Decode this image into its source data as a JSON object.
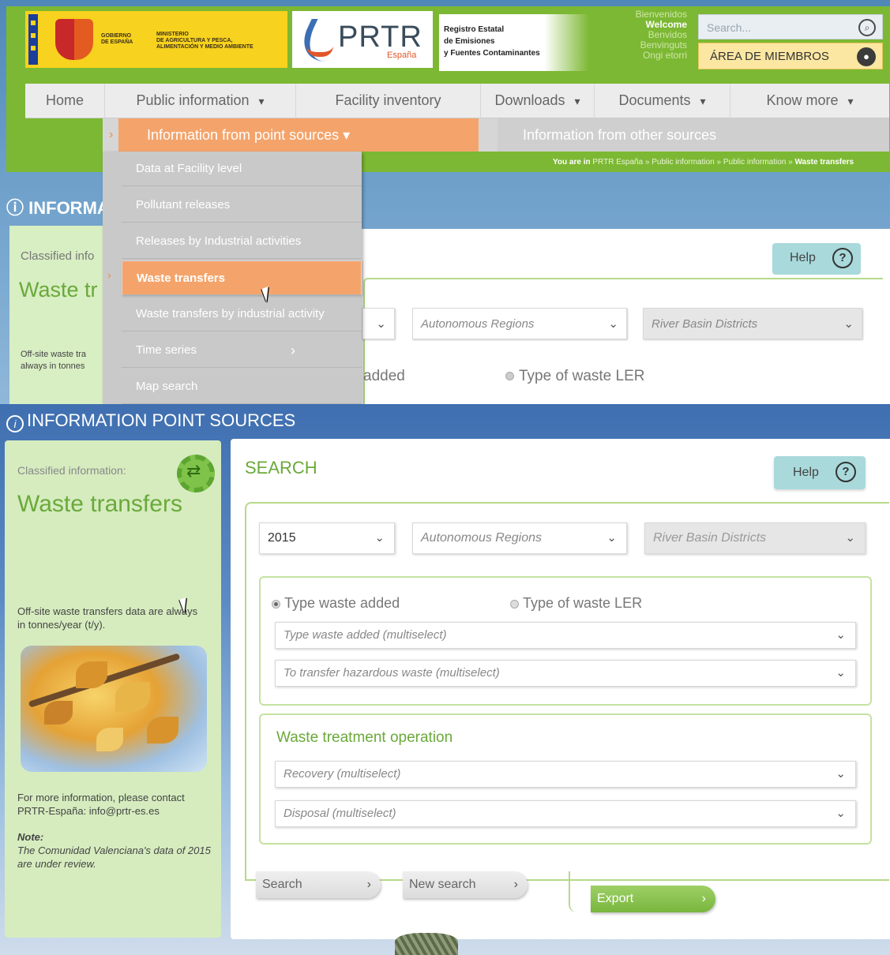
{
  "top": {
    "gov": {
      "line1": "GOBIERNO",
      "line2": "DE ESPAÑA",
      "ministry1": "MINISTERIO",
      "ministry2": "DE AGRICULTURA Y PESCA,",
      "ministry3": "ALIMENTACIÓN Y MEDIO AMBIENTE"
    },
    "brand": {
      "name": "PRTR",
      "country": "España",
      "reg1": "Registro Estatal",
      "reg2": "de Emisiones",
      "reg3": "y Fuentes Contaminantes"
    },
    "welcome": [
      "Bienvenidos",
      "Welcome",
      "Benvidos",
      "Benvinguts",
      "Ongi etorri"
    ],
    "search_placeholder": "Search...",
    "members_label": "ÁREA DE MIEMBROS",
    "nav": [
      "Home",
      "Public information",
      "Facility inventory",
      "Downloads",
      "Documents",
      "Know more"
    ],
    "subnav": {
      "active": "Information from point sources",
      "other": "Information from other sources"
    },
    "breadcrumb": {
      "prefix": "You are in",
      "path": "PRTR España » Public information » Public information » ",
      "current": "Waste transfers"
    },
    "dropdown": [
      "Data at Facility level",
      "Pollutant releases",
      "Releases by Industrial activities",
      "Waste transfers",
      "Waste transfers by industrial activity",
      "Time series",
      "Map search"
    ],
    "info_title": "INFORMA",
    "classified": "Classified info",
    "waste_title": "Waste tr",
    "offsite1": "Off-site waste tra",
    "offsite2": "always in tonnes",
    "help": "Help",
    "autonomous": "Autonomous Regions",
    "river": "River Basin Districts",
    "radio1": "added",
    "radio2": "Type of waste LER"
  },
  "bottom": {
    "title": "INFORMATION POINT SOURCES",
    "sidebar": {
      "classified": "Classified information:",
      "heading": "Waste transfers",
      "offsite": "Off-site waste transfers data are always in tonnes/year (t/y).",
      "more": "For more information, please contact PRTR-España: info@prtr-es.es",
      "note_label": "Note:",
      "note": "The Comunidad Valenciana's data of 2015 are under review."
    },
    "search_title": "SEARCH",
    "help": "Help",
    "year": "2015",
    "autonomous": "Autonomous Regions",
    "river": "River Basin Districts",
    "radio_waste_added": "Type waste added",
    "radio_ler": "Type of waste LER",
    "type_waste_select": "Type waste added (multiselect)",
    "hazardous_select": "To transfer hazardous waste (multiselect)",
    "wto_title": "Waste treatment operation",
    "recovery_select": "Recovery (multiselect)",
    "disposal_select": "Disposal (multiselect)",
    "btn_search": "Search",
    "btn_new": "New search",
    "btn_export": "Export"
  },
  "colors": {
    "header_green": "#7cb833",
    "accent_orange": "#f4a46b",
    "title_green": "#6aa93a",
    "help_teal": "#a9d9db"
  },
  "icons": [
    "search-icon",
    "user-icon",
    "help-icon",
    "chevron-down-icon",
    "chevron-right-icon",
    "info-icon",
    "classified-gear-icon"
  ]
}
